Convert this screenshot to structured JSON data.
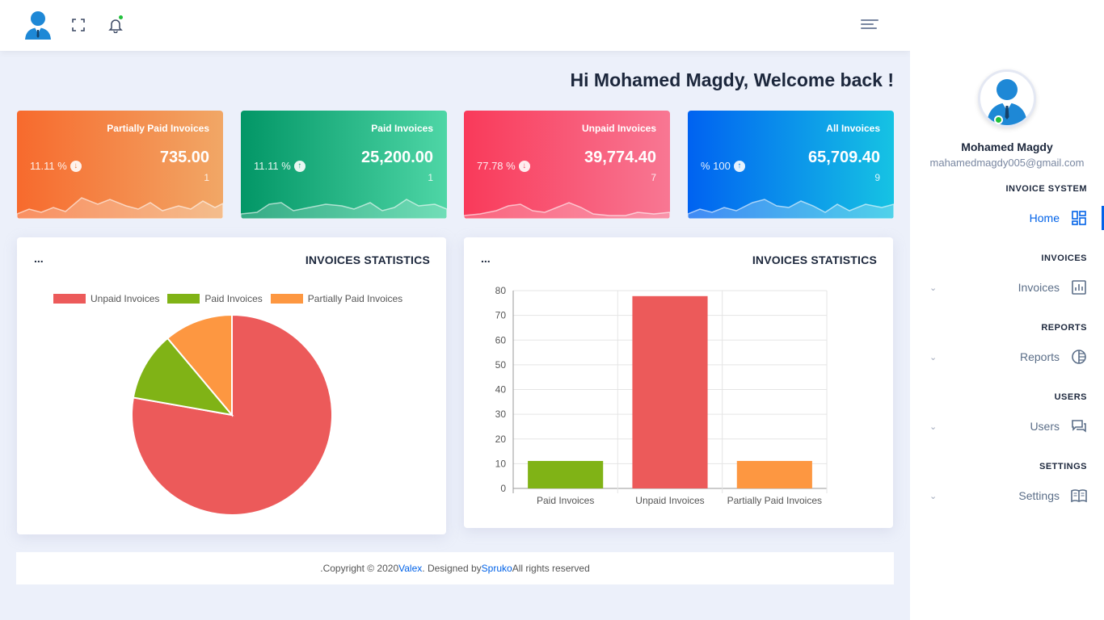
{
  "header": {
    "logo_icon": "user-avatar-icon",
    "fullscreen_icon": "fullscreen-icon",
    "notification_icon": "bell-icon",
    "menu_icon": "hamburger-icon"
  },
  "welcome": "Hi Mohamed Magdy, Welcome back !",
  "cards": [
    {
      "title": "Partially Paid Invoices",
      "amount": "735.00",
      "count": "1",
      "percent": "11.11 %",
      "trend": "down"
    },
    {
      "title": "Paid Invoices",
      "amount": "25,200.00",
      "count": "1",
      "percent": "11.11 %",
      "trend": "up"
    },
    {
      "title": "Unpaid Invoices",
      "amount": "39,774.40",
      "count": "7",
      "percent": "77.78 %",
      "trend": "down"
    },
    {
      "title": "All Invoices",
      "amount": "65,709.40",
      "count": "9",
      "percent": "% 100",
      "trend": "up"
    }
  ],
  "panels": {
    "pie": {
      "menu": "...",
      "title": "INVOICES STATISTICS"
    },
    "bar": {
      "menu": "...",
      "title": "INVOICES STATISTICS"
    }
  },
  "colors": {
    "unpaid": "#ec5a5a",
    "paid": "#80b316",
    "partial": "#fd9741",
    "primary": "#0162e8"
  },
  "chart_data": [
    {
      "type": "pie",
      "legend_placement": "top",
      "categories": [
        "Unpaid Invoices",
        "Paid Invoices",
        "Partially Paid Invoices"
      ],
      "values": [
        77.78,
        11.11,
        11.11
      ]
    },
    {
      "type": "bar",
      "categories": [
        "Paid Invoices",
        "Unpaid Invoices",
        "Partially Paid Invoices"
      ],
      "values": [
        11.11,
        77.78,
        11.11
      ],
      "ylim": [
        0,
        80
      ],
      "yticks": [
        "0",
        "10",
        "20",
        "30",
        "40",
        "50",
        "60",
        "70",
        "80"
      ],
      "grid": true
    }
  ],
  "footer": {
    "prefix": ".Copyright © 2020 ",
    "brand": "Valex",
    "middle": ". Designed by ",
    "designer": "Spruko",
    "suffix": " All rights reserved"
  },
  "sidebar": {
    "user_name": "Mohamed Magdy",
    "user_email": "mahamedmagdy005@gmail.com",
    "sections": [
      {
        "heading": "INVOICE SYSTEM",
        "item": "Home",
        "icon": "dashboard-icon",
        "active": true,
        "chevron": ""
      },
      {
        "heading": "INVOICES",
        "item": "Invoices",
        "icon": "bar-chart-icon",
        "active": false,
        "chevron": "⌄"
      },
      {
        "heading": "REPORTS",
        "item": "Reports",
        "icon": "pie-chart-icon",
        "active": false,
        "chevron": "⌄"
      },
      {
        "heading": "USERS",
        "item": "Users",
        "icon": "chat-icon",
        "active": false,
        "chevron": "⌄"
      },
      {
        "heading": "SETTINGS",
        "item": "Settings",
        "icon": "book-icon",
        "active": false,
        "chevron": "⌄"
      }
    ]
  }
}
